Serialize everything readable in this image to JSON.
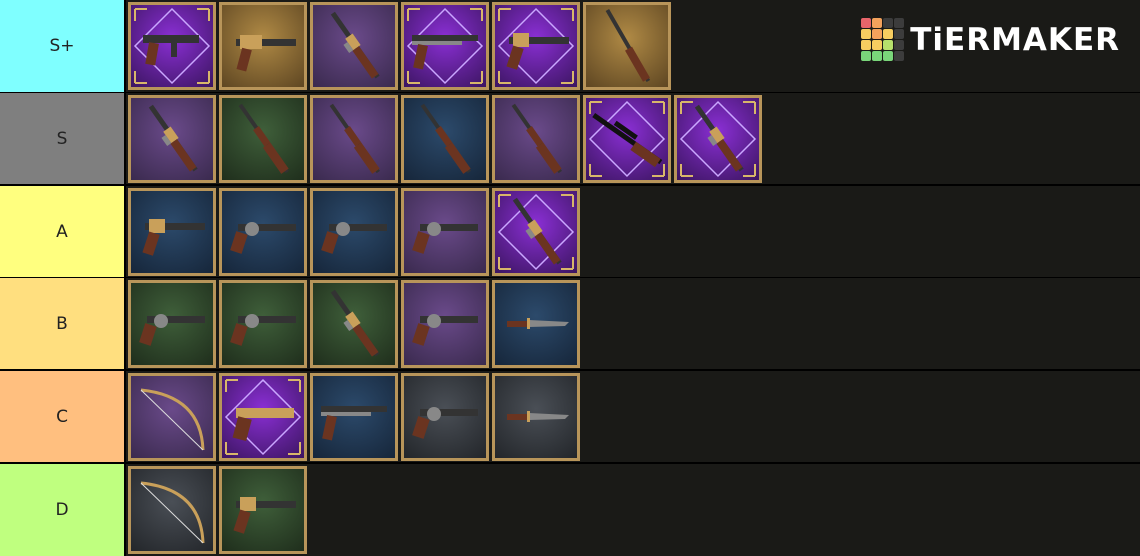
{
  "logo": {
    "text": "TiERMAKER"
  },
  "colors": {
    "background": "#1a1a17",
    "card_border": "#b8955a",
    "logo_cells": [
      "#e8656a",
      "#f4a25c",
      "#3c3c3c",
      "#3c3c3c",
      "#f7cd60",
      "#f4a25c",
      "#f7cd60",
      "#3c3c3c",
      "#f7cd60",
      "#f7cd60",
      "#b6e06c",
      "#3c3c3c",
      "#7ad67a",
      "#7ad67a",
      "#7ad67a",
      "#3c3c3c"
    ]
  },
  "tiers": [
    {
      "label": "S+",
      "color": "#7fffff",
      "items": [
        {
          "bg": "purple-ornate",
          "weapon": "smg-icon"
        },
        {
          "bg": "gold",
          "weapon": "lever-pistol-icon"
        },
        {
          "bg": "purple",
          "weapon": "lever-rifle-icon"
        },
        {
          "bg": "purple-ornate",
          "weapon": "shotgun-icon"
        },
        {
          "bg": "purple-ornate",
          "weapon": "pistol-icon"
        },
        {
          "bg": "gold",
          "weapon": "long-rifle-icon"
        }
      ]
    },
    {
      "label": "S",
      "color": "#7f7f7f",
      "items": [
        {
          "bg": "purple",
          "weapon": "lever-rifle-icon"
        },
        {
          "bg": "green",
          "weapon": "rifle-icon"
        },
        {
          "bg": "purple",
          "weapon": "rifle-icon"
        },
        {
          "bg": "blue",
          "weapon": "rifle-icon"
        },
        {
          "bg": "purple",
          "weapon": "rifle-icon"
        },
        {
          "bg": "purple-ornate",
          "weapon": "sniper-icon"
        },
        {
          "bg": "purple-ornate",
          "weapon": "lever-rifle-icon"
        }
      ]
    },
    {
      "label": "A",
      "color": "#ffff7f",
      "items": [
        {
          "bg": "blue",
          "weapon": "pistol-icon"
        },
        {
          "bg": "blue",
          "weapon": "revolver-icon"
        },
        {
          "bg": "blue",
          "weapon": "revolver-icon"
        },
        {
          "bg": "purple",
          "weapon": "revolver-icon"
        },
        {
          "bg": "purple-ornate",
          "weapon": "lever-rifle-icon"
        }
      ]
    },
    {
      "label": "B",
      "color": "#ffdf7f",
      "items": [
        {
          "bg": "green",
          "weapon": "revolver-icon"
        },
        {
          "bg": "green",
          "weapon": "revolver-icon"
        },
        {
          "bg": "green",
          "weapon": "lever-rifle-icon"
        },
        {
          "bg": "purple",
          "weapon": "revolver-icon"
        },
        {
          "bg": "blue",
          "weapon": "knife-icon"
        }
      ]
    },
    {
      "label": "C",
      "color": "#ffbf7f",
      "items": [
        {
          "bg": "purple",
          "weapon": "bow-icon"
        },
        {
          "bg": "purple-ornate",
          "weapon": "flare-gun-icon"
        },
        {
          "bg": "blue",
          "weapon": "shotgun-icon"
        },
        {
          "bg": "gray",
          "weapon": "revolver-icon"
        },
        {
          "bg": "gray",
          "weapon": "knife-icon"
        }
      ]
    },
    {
      "label": "D",
      "color": "#bfff7f",
      "items": [
        {
          "bg": "gray",
          "weapon": "bow-icon"
        },
        {
          "bg": "green",
          "weapon": "pistol-icon"
        }
      ]
    }
  ]
}
